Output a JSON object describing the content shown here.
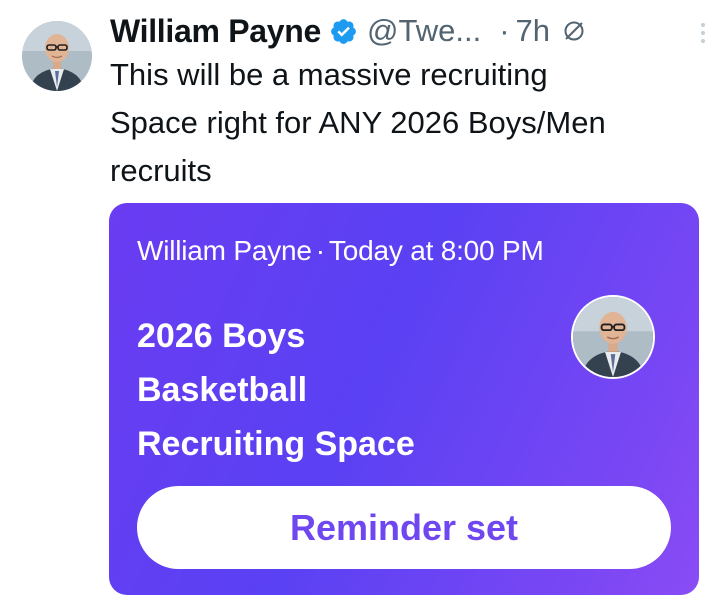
{
  "tweet": {
    "author_name": "William Payne",
    "handle": "@Twe...",
    "separator": "·",
    "time": "7h",
    "text_lines": [
      "This will be a massive recruiting",
      "Space right for ANY 2026 Boys/Men",
      "recruits"
    ],
    "icons": {
      "verified": "verified-badge-icon",
      "grok": "grok-icon",
      "more": "more-options-icon"
    },
    "colors": {
      "verified": "#1d9bf0",
      "secondary_text": "#536471",
      "primary_text": "#0f1419"
    }
  },
  "space_card": {
    "host": "William Payne",
    "separator": "·",
    "schedule": "Today at 8:00 PM",
    "title_lines": [
      "2026 Boys",
      "Basketball",
      "Recruiting Space"
    ],
    "button_label": "Reminder set",
    "colors": {
      "gradient_start": "#5a41f3",
      "gradient_end": "#8a4cf5",
      "button_text": "#6f47f0"
    }
  }
}
